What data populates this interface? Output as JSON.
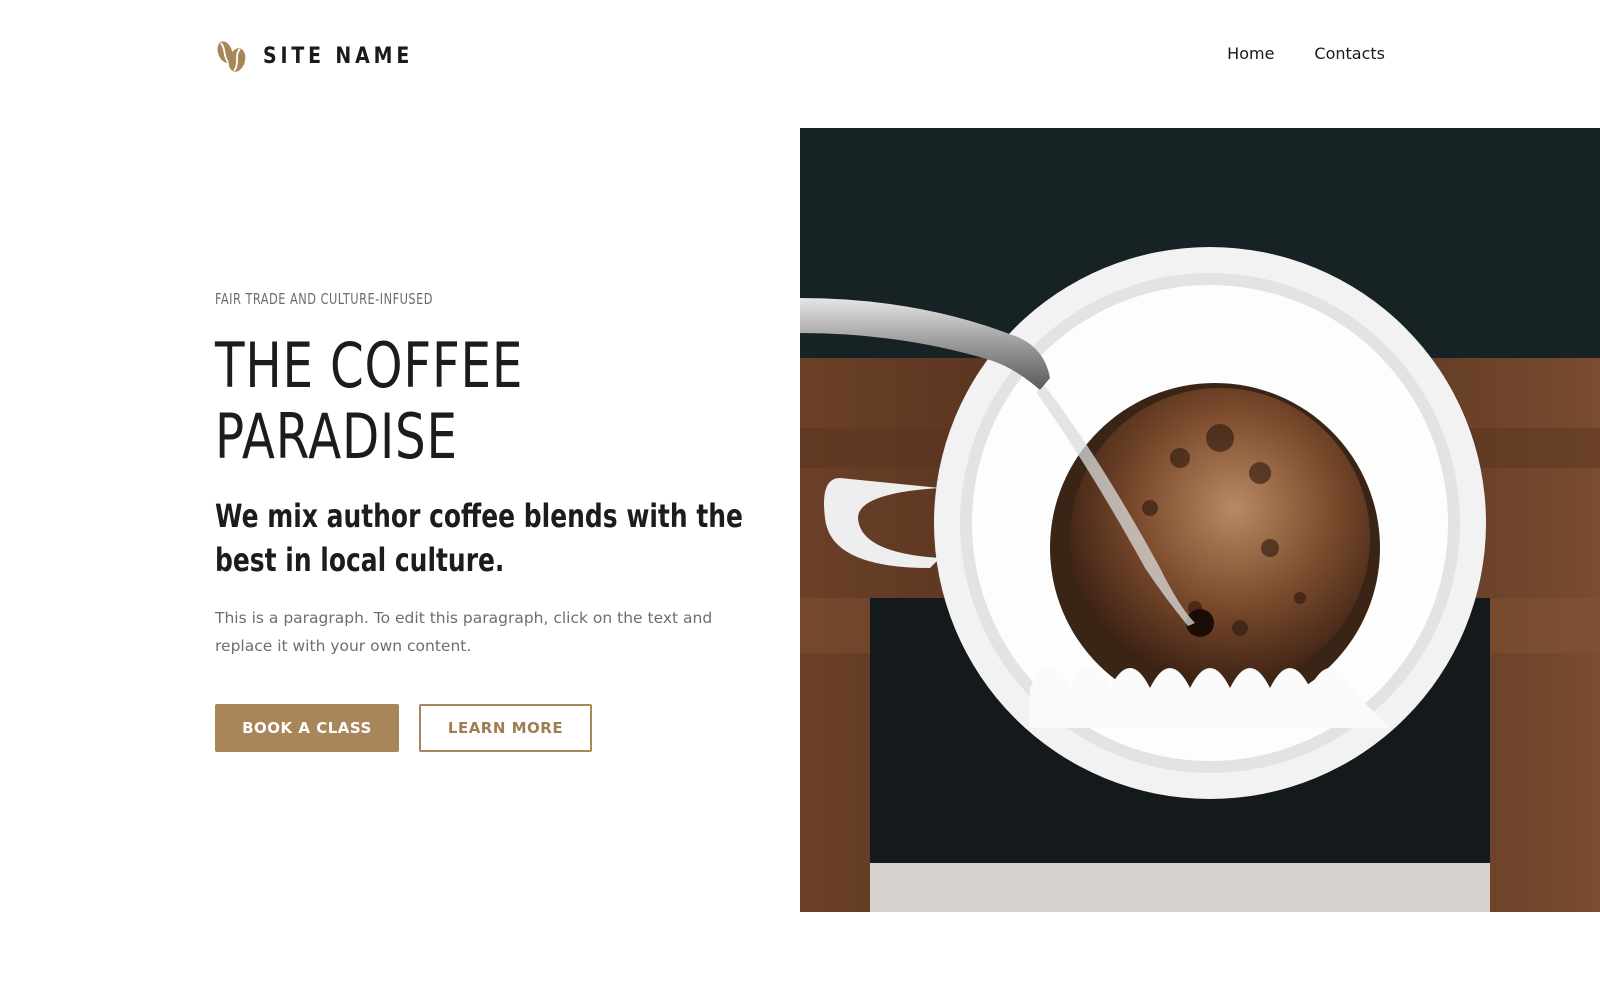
{
  "header": {
    "site_name": "SITE NAME",
    "logo_icon": "coffee-beans-icon",
    "nav": [
      {
        "label": "Home"
      },
      {
        "label": "Contacts"
      }
    ]
  },
  "hero": {
    "eyebrow": "FAIR TRADE AND CULTURE-INFUSED",
    "title_line1": "THE COFFEE",
    "title_line2": "PARADISE",
    "subtitle": "We mix author coffee blends with the best in local culture.",
    "paragraph": "This is a paragraph. To edit this paragraph, click on the text and replace it with your own content.",
    "primary_button": "BOOK A CLASS",
    "secondary_button": "LEARN MORE"
  },
  "colors": {
    "accent": "#a8865a",
    "text_dark": "#1c1c1c",
    "text_muted": "#6e6e6e"
  }
}
